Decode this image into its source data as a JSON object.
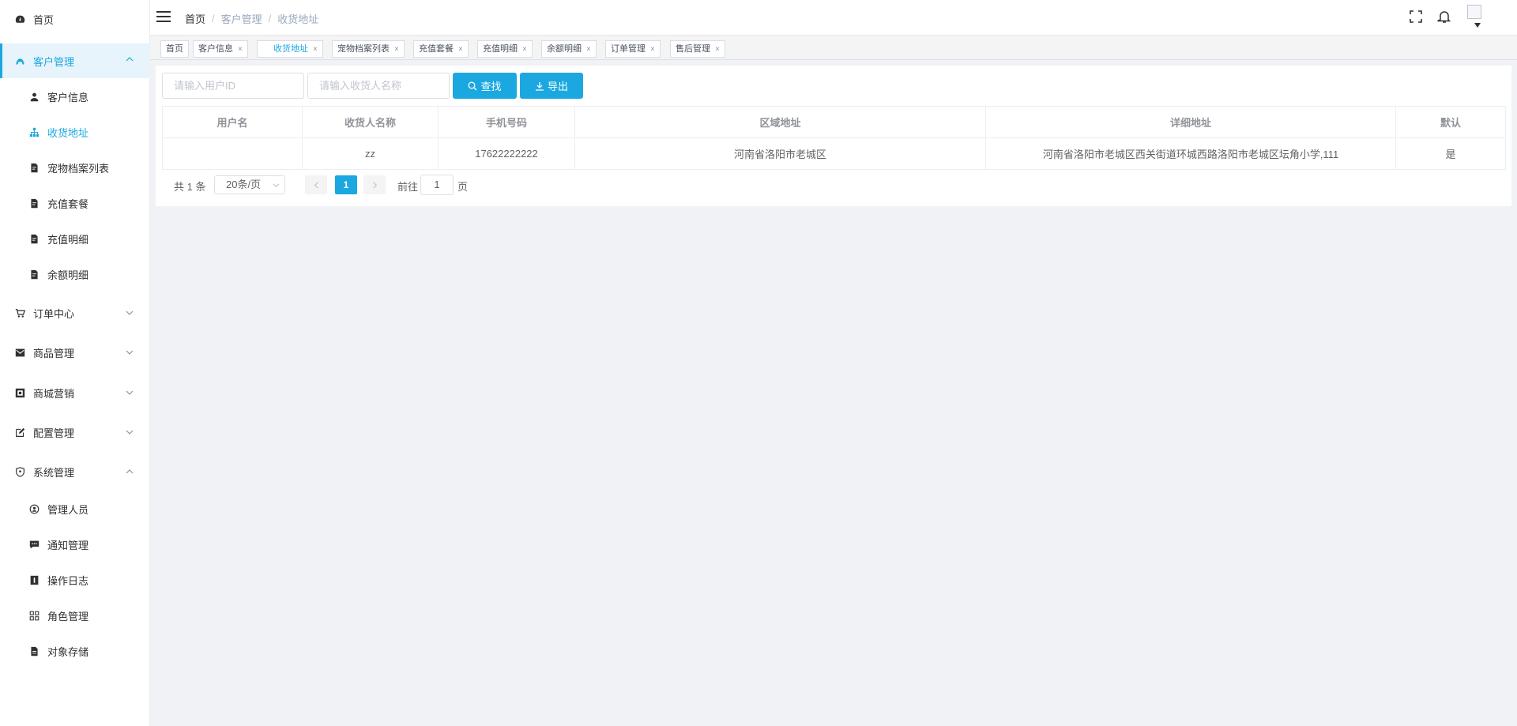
{
  "sidebar": {
    "home": "首页",
    "customer_group": "客户管理",
    "customer_items": [
      "客户信息",
      "收货地址",
      "宠物档案列表",
      "充值套餐",
      "充值明细",
      "余额明细"
    ],
    "order_center": "订单中心",
    "product_mgmt": "商品管理",
    "mall_marketing": "商城营销",
    "config_mgmt": "配置管理",
    "system_group": "系统管理",
    "system_items": [
      "管理人员",
      "通知管理",
      "操作日志",
      "角色管理",
      "对象存储"
    ]
  },
  "header": {
    "breadcrumb": [
      "首页",
      "客户管理",
      "收货地址"
    ]
  },
  "tags": [
    "首页",
    "客户信息",
    "收货地址",
    "宠物档案列表",
    "充值套餐",
    "充值明细",
    "余额明细",
    "订单管理",
    "售后管理"
  ],
  "close_glyph": "×",
  "search": {
    "user_id_placeholder": "请输入用户ID",
    "receiver_placeholder": "请输入收货人名称",
    "search_label": "查找",
    "export_label": "导出"
  },
  "table": {
    "columns": [
      "用户名",
      "收货人名称",
      "手机号码",
      "区域地址",
      "详细地址",
      "默认"
    ],
    "rows": [
      [
        "",
        "zz",
        "17622222222",
        "河南省洛阳市老城区",
        "河南省洛阳市老城区西关街道环城西路洛阳市老城区坛角小学,111",
        "是"
      ]
    ]
  },
  "pagination": {
    "total": "共 1 条",
    "page_size": "20条/页",
    "current_page": "1",
    "goto_label": "前往",
    "goto_value": "1",
    "page_unit": "页"
  },
  "colors": {
    "accent": "#1ba8e0",
    "sidebar_active_bg": "#e8f4fb"
  }
}
